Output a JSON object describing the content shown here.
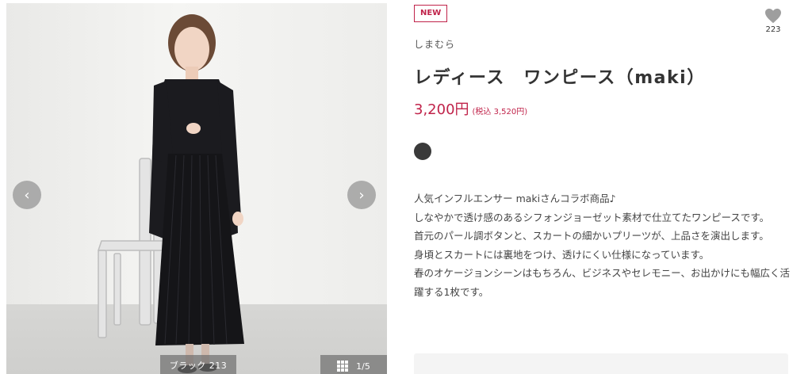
{
  "gallery": {
    "prev_icon": "chevron-left-icon",
    "next_icon": "chevron-right-icon",
    "prev_symbol": "‹",
    "next_symbol": "›",
    "color_caption": "ブラック 213",
    "counter": "1/5"
  },
  "product": {
    "badge": "NEW",
    "favorite_count": "223",
    "brand": "しまむら",
    "title": "レディース　ワンピース（maki）",
    "price": "3,200円",
    "price_tax": "(税込 3,520円)",
    "swatch_color": "#3a3a3a",
    "description": [
      "人気インフルエンサー makiさんコラボ商品♪",
      "しなやかで透け感のあるシフォンジョーゼット素材で仕立てたワンピースです。",
      "首元のパール調ボタンと、スカートの細かいプリーツが、上品さを演出します。",
      "身頃とスカートには裏地をつけ、透けにくい仕様になっています。",
      "春のオケージョンシーンはもちろん、ビジネスやセレモニー、お出かけにも幅広く活躍する1枚です。"
    ]
  },
  "colors": {
    "accent": "#c0234a",
    "heart": "#9e9e9e"
  }
}
